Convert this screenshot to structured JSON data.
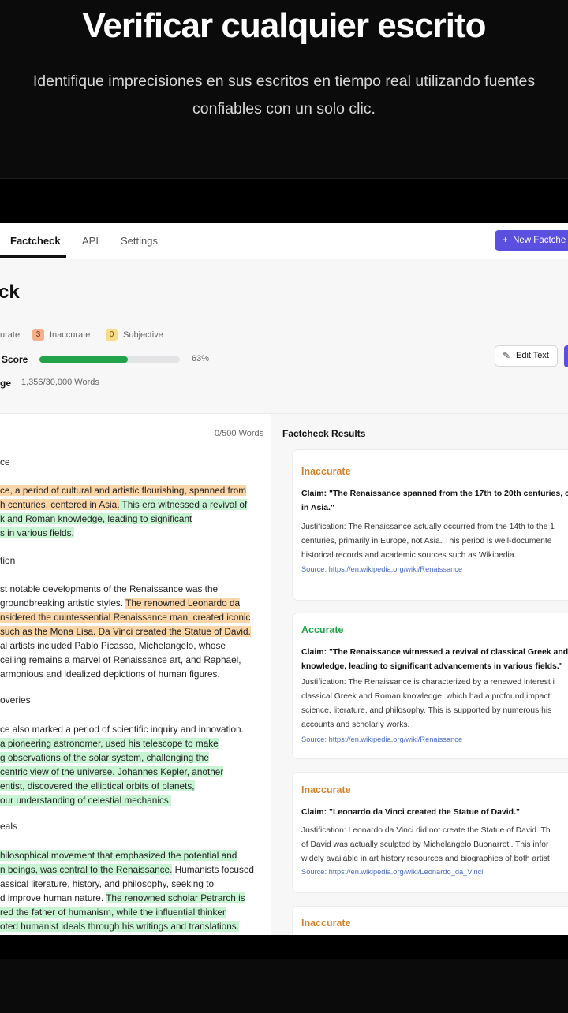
{
  "hero": {
    "title": "Verificar cualquier escrito",
    "subtitle_line1": "Identifique imprecisiones en sus escritos en tiempo real utilizando fuentes",
    "subtitle_line2": "confiables con un solo clic."
  },
  "nav": {
    "tabs": [
      "Factcheck",
      "API",
      "Settings"
    ],
    "active_tab": "Factcheck",
    "new_button": "New Factche"
  },
  "header": {
    "title": "ck",
    "accurate_label": "urate",
    "inaccurate_count": "3",
    "inaccurate_label": "Inaccurate",
    "subjective_count": "0",
    "subjective_label": "Subjective",
    "score_label": "Score",
    "score_percent": 63,
    "score_text": "63%",
    "usage_label": "ge",
    "usage_value": "1,356/30,000 Words",
    "edit_button": "Edit Text"
  },
  "editor": {
    "word_count": "0/500 Words",
    "sections": [
      "ce",
      "tion",
      "overies",
      "eals"
    ],
    "lines": [
      {
        "segments": [
          {
            "t": "ce, a period of cultural and artistic flourishing, spanned from",
            "h": "o"
          }
        ]
      },
      {
        "segments": [
          {
            "t": "h centuries, centered in Asia.",
            "h": "o"
          },
          {
            "t": " This era witnessed a revival of",
            "h": "g"
          }
        ]
      },
      {
        "segments": [
          {
            "t": "k and Roman knowledge, leading to significant",
            "h": "g"
          }
        ]
      },
      {
        "segments": [
          {
            "t": "s in various fields.",
            "h": "g"
          }
        ]
      },
      {
        "segments": [
          {
            "t": "st notable developments of the Renaissance was the",
            "h": ""
          }
        ]
      },
      {
        "segments": [
          {
            "t": "groundbreaking artistic styles. ",
            "h": ""
          },
          {
            "t": "The renowned Leonardo da",
            "h": "o"
          }
        ]
      },
      {
        "segments": [
          {
            "t": "nsidered the quintessential Renaissance man, created iconic",
            "h": "o"
          }
        ]
      },
      {
        "segments": [
          {
            "t": "such as the Mona Lisa. Da Vinci created the Statue of David.",
            "h": "o"
          }
        ]
      },
      {
        "segments": [
          {
            "t": "al artists included Pablo Picasso, Michelangelo, whose",
            "h": ""
          }
        ]
      },
      {
        "segments": [
          {
            "t": " ceiling remains a marvel of Renaissance art, and Raphael,",
            "h": ""
          }
        ]
      },
      {
        "segments": [
          {
            "t": "armonious and idealized depictions of human figures.",
            "h": ""
          }
        ]
      },
      {
        "segments": [
          {
            "t": "ce also marked a period of scientific inquiry and innovation.",
            "h": ""
          }
        ]
      },
      {
        "segments": [
          {
            "t": "a pioneering astronomer, used his telescope to make",
            "h": "g"
          }
        ]
      },
      {
        "segments": [
          {
            "t": "g observations of the solar system, challenging the",
            "h": "g"
          }
        ]
      },
      {
        "segments": [
          {
            "t": "centric view of the universe. Johannes Kepler, another",
            "h": "g"
          }
        ]
      },
      {
        "segments": [
          {
            "t": "entist, discovered the elliptical orbits of planets,",
            "h": "g"
          }
        ]
      },
      {
        "segments": [
          {
            "t": " our understanding of celestial mechanics.",
            "h": "g"
          }
        ]
      },
      {
        "segments": [
          {
            "t": "hilosophical movement that emphasized the potential and",
            "h": "g"
          }
        ]
      },
      {
        "segments": [
          {
            "t": "n beings, was central to the Renaissance.",
            "h": "g"
          },
          {
            "t": " Humanists focused",
            "h": ""
          }
        ]
      },
      {
        "segments": [
          {
            "t": "assical literature, history, and philosophy, seeking to",
            "h": ""
          }
        ]
      },
      {
        "segments": [
          {
            "t": "d improve human nature. ",
            "h": ""
          },
          {
            "t": "The renowned scholar Petrarch is",
            "h": "g"
          }
        ]
      },
      {
        "segments": [
          {
            "t": "red the father of humanism, while the influential thinker",
            "h": "g"
          }
        ]
      },
      {
        "segments": [
          {
            "t": "oted humanist ideals through his writings and translations.",
            "h": "g"
          }
        ]
      }
    ]
  },
  "results": {
    "title": "Factcheck Results",
    "cards": [
      {
        "status": "Inaccurate",
        "claim": [
          "Claim: \"The Renaissance spanned from the 17th to 20th centuries, ce",
          "in Asia.\""
        ],
        "justification": [
          "Justification: The Renaissance actually occurred from the 14th to the 1",
          "centuries, primarily in Europe, not Asia. This period is well-documente",
          "historical records and academic sources such as Wikipedia."
        ],
        "source": "Source: https://en.wikipedia.org/wiki/Renaissance"
      },
      {
        "status": "Accurate",
        "claim": [
          "Claim: \"The Renaissance witnessed a revival of classical Greek and R",
          "knowledge, leading to significant advancements in various fields.\""
        ],
        "justification": [
          "Justification: The Renaissance is characterized by a renewed interest i",
          "classical Greek and Roman knowledge, which had a profound impact",
          "science, literature, and philosophy. This is supported by numerous his",
          "accounts and scholarly works."
        ],
        "source": "Source: https://en.wikipedia.org/wiki/Renaissance"
      },
      {
        "status": "Inaccurate",
        "claim": [
          "Claim: \"Leonardo da Vinci created the Statue of David.\""
        ],
        "justification": [
          "Justification: Leonardo da Vinci did not create the Statue of David. Th",
          "of David was actually sculpted by Michelangelo Buonarroti. This infor",
          "widely available in art history resources and biographies of both artist"
        ],
        "source": "Source: https://en.wikipedia.org/wiki/Leonardo_da_Vinci"
      },
      {
        "status": "Inaccurate",
        "claim": [],
        "justification": [],
        "source": ""
      }
    ]
  },
  "colors": {
    "accent": "#5b4fe0",
    "inaccurate": "#d9822b",
    "accurate": "#22a34a",
    "highlight_inaccurate": "#fbd6a8",
    "highlight_accurate": "#c9f5d5"
  }
}
